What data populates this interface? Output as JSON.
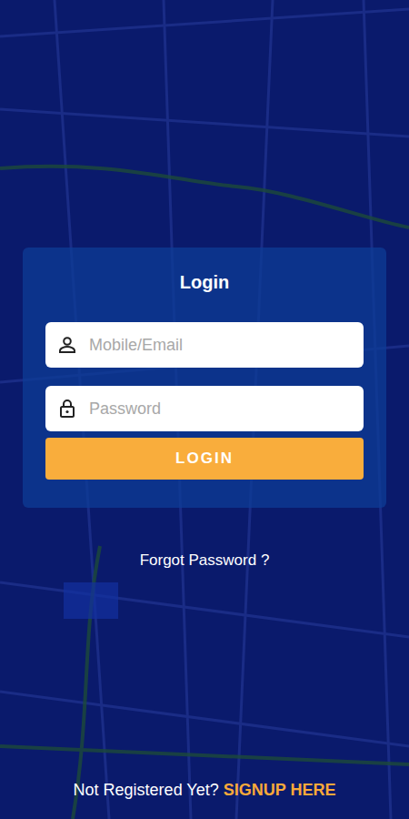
{
  "login_card": {
    "title": "Login",
    "fields": [
      {
        "kind": "user",
        "placeholder": "Mobile/Email"
      },
      {
        "kind": "password",
        "placeholder": "Password"
      }
    ],
    "button": "LOGIN"
  },
  "forgot_password": "Forgot Password ?",
  "footer": {
    "prompt": "Not Registered Yet?",
    "link": "SIGNUP HERE"
  }
}
